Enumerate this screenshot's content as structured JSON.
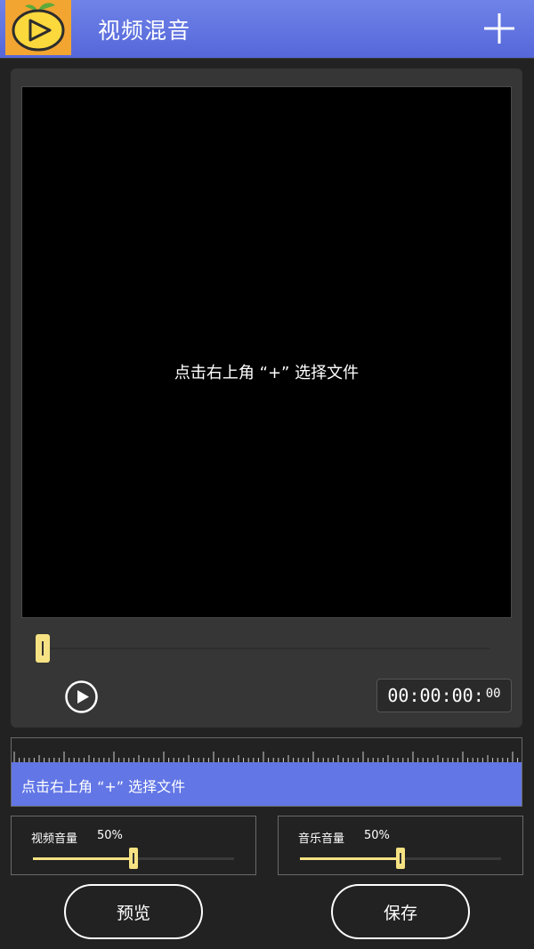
{
  "header": {
    "title": "视频混音",
    "add_icon": "plus-icon",
    "logo_icon": "mango-play-logo",
    "background": "#5f73e2"
  },
  "preview": {
    "hint": "点击右上角 “+” 选择文件",
    "play_icon": "play-circle-icon",
    "time_main": "00:00:00:",
    "time_frac": "00",
    "seek_position": 0
  },
  "timeline": {
    "hint": "点击右上角 “+” 选择文件",
    "strip_color": "#6276e6"
  },
  "volume": {
    "video": {
      "label": "视频音量",
      "value_text": "50%",
      "level": 0.5
    },
    "music": {
      "label": "音乐音量",
      "value_text": "50%",
      "level": 0.5
    }
  },
  "actions": {
    "preview_label": "预览",
    "save_label": "保存"
  },
  "accent_color": "#f6e283"
}
